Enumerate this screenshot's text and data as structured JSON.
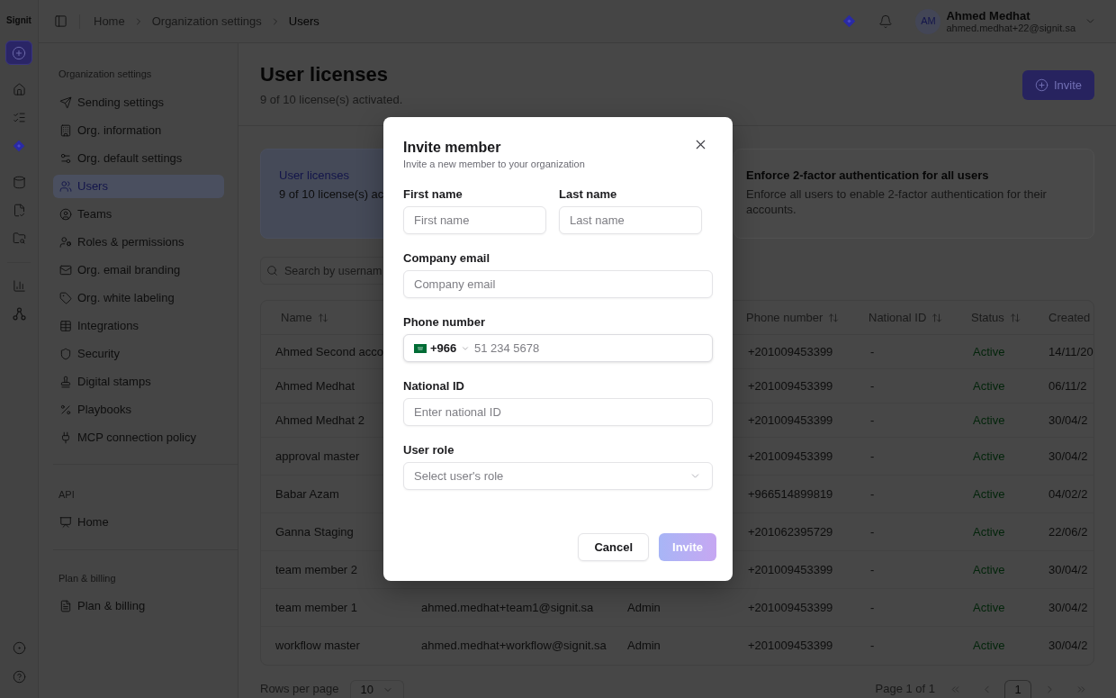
{
  "rail": {
    "logo": "Signit"
  },
  "header": {
    "breadcrumbs": [
      {
        "label": "Home",
        "current": false
      },
      {
        "label": "Organization settings",
        "current": false
      },
      {
        "label": "Users",
        "current": true
      }
    ],
    "user": {
      "initials": "AM",
      "name": "Ahmed Medhat",
      "email": "ahmed.medhat+22@signit.sa"
    }
  },
  "sidebar": {
    "sections": [
      {
        "title": "Organization settings",
        "items": [
          {
            "label": "Sending settings",
            "selected": false
          },
          {
            "label": "Org. information",
            "selected": false
          },
          {
            "label": "Org. default settings",
            "selected": false
          },
          {
            "label": "Users",
            "selected": true
          },
          {
            "label": "Teams",
            "selected": false
          },
          {
            "label": "Roles & permissions",
            "selected": false
          },
          {
            "label": "Org. email branding",
            "selected": false
          },
          {
            "label": "Org. white labeling",
            "selected": false
          },
          {
            "label": "Integrations",
            "selected": false
          },
          {
            "label": "Security",
            "selected": false
          },
          {
            "label": "Digital stamps",
            "selected": false
          },
          {
            "label": "Playbooks",
            "selected": false
          },
          {
            "label": "MCP connection policy",
            "selected": false
          }
        ]
      },
      {
        "title": "API",
        "items": [
          {
            "label": "Home",
            "selected": false
          }
        ]
      },
      {
        "title": "Plan & billing",
        "items": [
          {
            "label": "Plan & billing",
            "selected": false
          }
        ]
      }
    ]
  },
  "page": {
    "title": "User licenses",
    "subtitle": "9 of 10 license(s) activated.",
    "invite_button": "Invite"
  },
  "cards": [
    {
      "kind": "usage",
      "title": "User licenses",
      "text": "9 of 10 license(s) ac"
    },
    {
      "kind": "setting",
      "title": "Enforce 2-factor authentication for all users",
      "text": "Enforce all users to enable 2-factor authentication for their accounts."
    }
  ],
  "search": {
    "placeholder": "Search by usernam"
  },
  "table": {
    "columns": {
      "name": {
        "label": "Name",
        "sortable": true
      },
      "phone_number": {
        "label": "Phone number",
        "sortable": true
      },
      "national_id": {
        "label": "National ID",
        "sortable": true
      },
      "status": {
        "label": "Status",
        "sortable": true
      },
      "created": {
        "label": "Created",
        "sortable": false
      }
    },
    "rows": [
      {
        "name": "Ahmed Second acco",
        "phone_number": "+201009453399",
        "national_id": "-",
        "status": "Active",
        "created": "14/11/20"
      },
      {
        "name": "Ahmed Medhat",
        "phone_number": "+201009453399",
        "national_id": "-",
        "status": "Active",
        "created": "06/11/2"
      },
      {
        "name": "Ahmed Medhat 2",
        "phone_number": "+201009453399",
        "national_id": "-",
        "status": "Active",
        "created": "30/04/2"
      },
      {
        "name": "approval master",
        "phone_number": "+201009453399",
        "national_id": "-",
        "status": "Active",
        "created": "30/04/2"
      },
      {
        "name": "Babar Azam",
        "phone_number": "+966514899819",
        "national_id": "-",
        "status": "Active",
        "created": "04/02/2"
      },
      {
        "name": "Ganna Staging",
        "phone_number": "+201062395729",
        "national_id": "-",
        "status": "Active",
        "created": "22/06/2"
      },
      {
        "name": "team member 2",
        "phone_number": "+201009453399",
        "national_id": "-",
        "status": "Active",
        "created": "30/04/2"
      },
      {
        "name": "team member 1",
        "column_2": "ahmed.medhat+team1@signit.sa",
        "column_3": "Admin",
        "phone_number": "+201009453399",
        "national_id": "-",
        "status": "Active",
        "created": "30/04/2"
      },
      {
        "name": "workflow master",
        "column_2": "ahmed.medhat+workflow@signit.sa",
        "column_3": "Admin",
        "phone_number": "+201009453399",
        "national_id": "-",
        "status": "Active",
        "created": "30/04/2"
      }
    ]
  },
  "pagination": {
    "rows_per_page_label": "Rows per page",
    "rows_per_page": "10",
    "page_label": "Page 1 of 1",
    "controls": [
      {
        "kind": "first",
        "disabled": true
      },
      {
        "kind": "previous",
        "disabled": true
      },
      {
        "kind": "page",
        "label": "1",
        "selected": true
      },
      {
        "kind": "next",
        "disabled": true
      },
      {
        "kind": "last",
        "disabled": true
      }
    ]
  },
  "modal": {
    "title": "Invite member",
    "subtitle": "Invite a new member to your organization",
    "field_rows": [
      [
        {
          "kind": "text",
          "label": "First name",
          "placeholder": "First name"
        },
        {
          "kind": "text",
          "label": "Last name",
          "placeholder": "Last name"
        }
      ],
      [
        {
          "kind": "text",
          "label": "Company email",
          "placeholder": "Company email"
        }
      ],
      [
        {
          "kind": "phone",
          "label": "Phone number",
          "country_code": "+966",
          "placeholder": "51 234 5678"
        }
      ],
      [
        {
          "kind": "text",
          "label": "National ID",
          "placeholder": "Enter national ID"
        }
      ],
      [
        {
          "kind": "select",
          "label": "User role",
          "placeholder": "Select user's role"
        }
      ]
    ],
    "buttons": [
      {
        "kind": "secondary",
        "label": "Cancel",
        "disabled": false
      },
      {
        "kind": "primary",
        "label": "Invite",
        "disabled": true
      }
    ]
  }
}
